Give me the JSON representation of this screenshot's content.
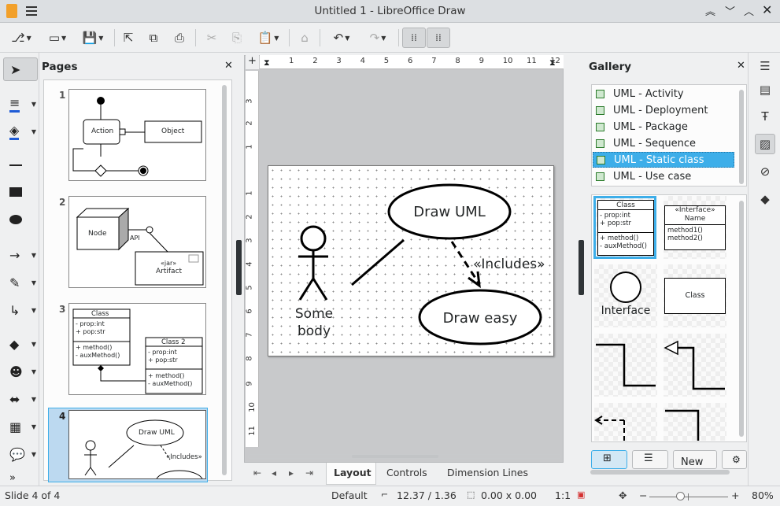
{
  "window": {
    "title": "Untitled 1 - LibreOffice Draw"
  },
  "pages_panel": {
    "title": "Pages",
    "numbers": [
      "1",
      "2",
      "3",
      "4"
    ],
    "p1": {
      "action": "Action",
      "object": "Object"
    },
    "p2": {
      "node": "Node",
      "api": "API",
      "jar": "«jar»",
      "artifact": "Artifact"
    },
    "p3": {
      "class": "Class",
      "prop": "- prop:int",
      "pop": "+ pop:str",
      "method": "+ method()",
      "aux": "- auxMethod()",
      "class2": "Class 2"
    },
    "p4": {
      "drawuml": "Draw UML",
      "includes": "«Includes»"
    }
  },
  "ruler": {
    "h": [
      "1",
      "2",
      "3",
      "4",
      "5",
      "6",
      "7",
      "8",
      "9",
      "10",
      "11",
      "12"
    ],
    "v": [
      "3",
      "2",
      "1",
      "1",
      "2",
      "3",
      "4",
      "5",
      "6",
      "7",
      "8",
      "9",
      "10",
      "11"
    ]
  },
  "slide": {
    "draw_uml": "Draw UML",
    "draw_easy": "Draw easy",
    "includes": "«Includes»",
    "actor_line1": "Some",
    "actor_line2": "body"
  },
  "tabs": [
    "Layout",
    "Controls",
    "Dimension Lines"
  ],
  "gallery": {
    "title": "Gallery",
    "themes": [
      "UML - Activity",
      "UML - Deployment",
      "UML - Package",
      "UML - Sequence",
      "UML - Static class",
      "UML - Use case"
    ],
    "selected_index": 4,
    "items": {
      "class_title": "Class",
      "class_prop": "- prop:int",
      "class_pop": "+ pop:str",
      "class_method": "+ method()",
      "class_aux": "- auxMethod()",
      "iface_stereo": "«Interface»",
      "iface_name": "Name",
      "iface_m1": "method1()",
      "iface_m2": "method2()",
      "interface": "Interface",
      "class2": "Class"
    },
    "new_button": "New"
  },
  "statusbar": {
    "slide": "Slide 4 of 4",
    "layout": "Default",
    "position": "12.37 / 1.36",
    "size": "0.00 x 0.00",
    "scale": "1:1",
    "zoom": "80%"
  },
  "colors": {
    "accent": "#3daee9",
    "selection": "#3daee9"
  }
}
